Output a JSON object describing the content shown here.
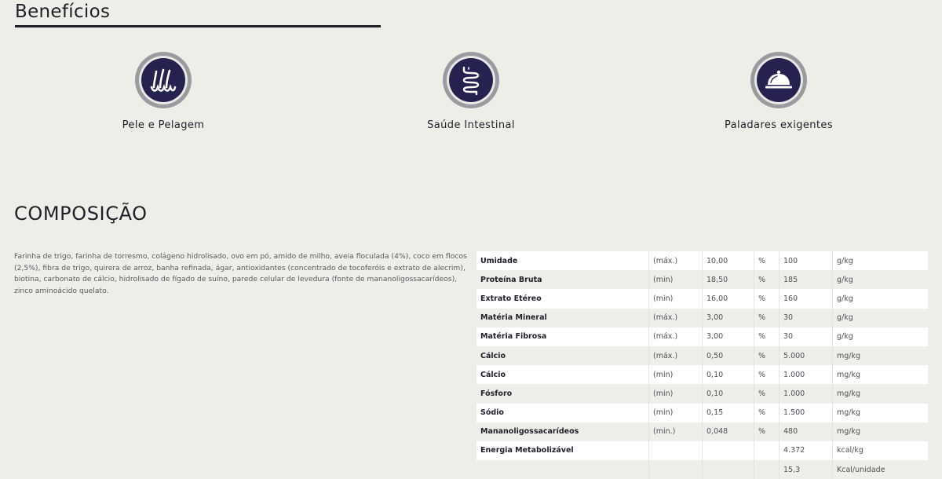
{
  "benefits": {
    "title": "Benefícios",
    "items": [
      {
        "label": "Pele e Pelagem",
        "icon": "hair-follicle-icon"
      },
      {
        "label": "Saúde Intestinal",
        "icon": "intestine-icon"
      },
      {
        "label": "Paladares exigentes",
        "icon": "food-cloche-icon"
      }
    ]
  },
  "composition": {
    "title": "COMPOSIÇÃO",
    "text": "Farinha de trigo, farinha de torresmo, colágeno hidrolisado, ovo em pó, amido de milho, aveia floculada (4%), coco em flocos (2,5%), fibra de trigo, quirera de arroz, banha refinada, ágar, antioxidantes (concentrado de tocoferóis e extrato de alecrim), biotina, carbonato de cálcio, hidrolisado de fígado de suíno, parede celular de levedura (fonte de mananoligossacarídeos), zinco aminoácido quelato."
  },
  "table": {
    "rows": [
      {
        "name": "Umidade",
        "qualifier": "(máx.)",
        "percent": "10,00",
        "pct_unit": "%",
        "value": "100",
        "unit": "g/kg"
      },
      {
        "name": "Proteína Bruta",
        "qualifier": "(min)",
        "percent": "18,50",
        "pct_unit": "%",
        "value": "185",
        "unit": "g/kg"
      },
      {
        "name": "Extrato Etéreo",
        "qualifier": "(min)",
        "percent": "16,00",
        "pct_unit": "%",
        "value": "160",
        "unit": "g/kg"
      },
      {
        "name": "Matéria Mineral",
        "qualifier": "(máx.)",
        "percent": "3,00",
        "pct_unit": "%",
        "value": "30",
        "unit": "g/kg"
      },
      {
        "name": "Matéria Fibrosa",
        "qualifier": "(máx.)",
        "percent": "3,00",
        "pct_unit": "%",
        "value": "30",
        "unit": "g/kg"
      },
      {
        "name": "Cálcio",
        "qualifier": "(máx.)",
        "percent": "0,50",
        "pct_unit": "%",
        "value": "5.000",
        "unit": "mg/kg"
      },
      {
        "name": "Cálcio",
        "qualifier": "(min)",
        "percent": "0,10",
        "pct_unit": "%",
        "value": "1.000",
        "unit": "mg/kg"
      },
      {
        "name": "Fósforo",
        "qualifier": "(min)",
        "percent": "0,10",
        "pct_unit": "%",
        "value": "1.000",
        "unit": "mg/kg"
      },
      {
        "name": "Sódio",
        "qualifier": "(min)",
        "percent": "0,15",
        "pct_unit": "%",
        "value": "1.500",
        "unit": "mg/kg"
      },
      {
        "name": "Mananoligossacarídeos",
        "qualifier": "(min.)",
        "percent": "0,048",
        "pct_unit": "%",
        "value": "480",
        "unit": "mg/kg"
      },
      {
        "name": "Energia Metabolizável",
        "qualifier": "",
        "percent": "",
        "pct_unit": "",
        "value": "4.372",
        "unit": "kcal/kg"
      },
      {
        "name": "",
        "qualifier": "",
        "percent": "",
        "pct_unit": "",
        "value": "15,3",
        "unit": "Kcal/unidade"
      }
    ]
  },
  "colors": {
    "background": "#eeede8",
    "icon_core": "#25224f",
    "icon_ring": "#9b9aa0",
    "text_dark": "#1f1f2a"
  }
}
